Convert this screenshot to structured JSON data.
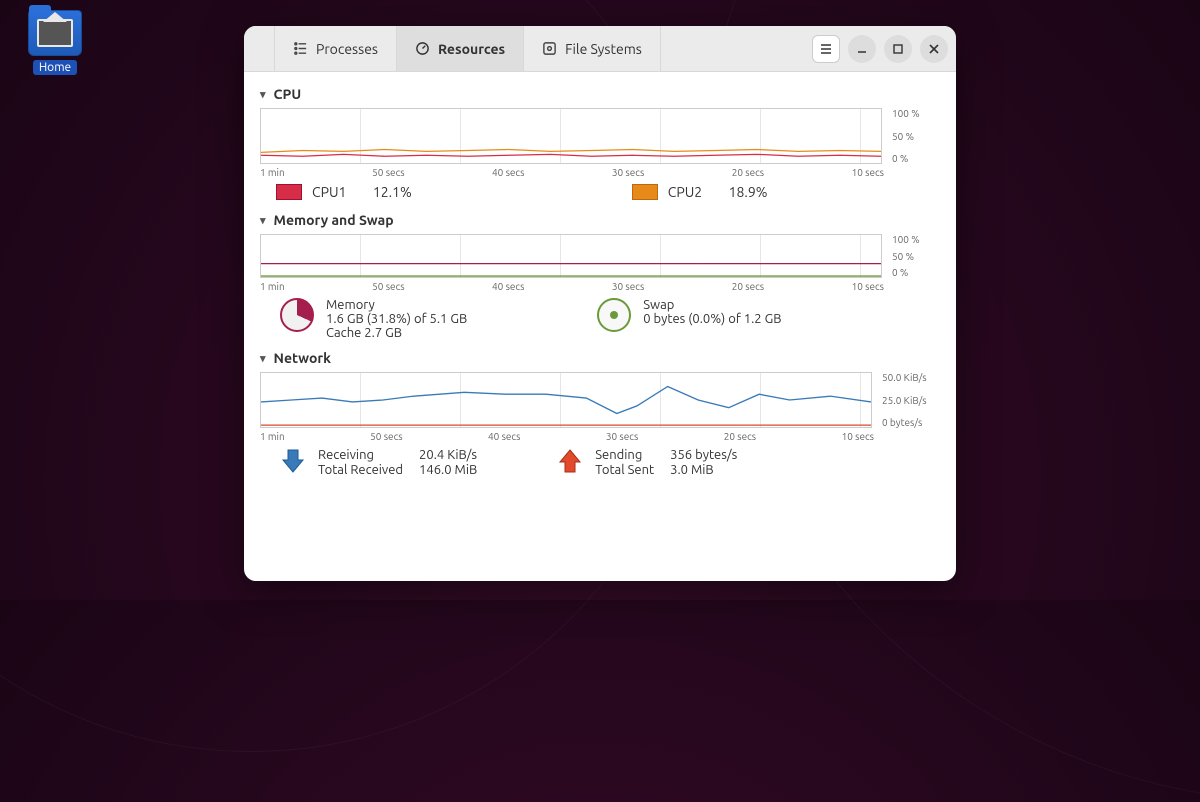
{
  "desktop": {
    "home_label": "Home"
  },
  "tabs": {
    "processes": "Processes",
    "resources": "Resources",
    "filesystems": "File Systems"
  },
  "sections": {
    "cpu": "CPU",
    "mem": "Memory and Swap",
    "net": "Network"
  },
  "xticks": [
    "1 min",
    "50 secs",
    "40 secs",
    "30 secs",
    "20 secs",
    "10 secs"
  ],
  "cpu": {
    "yticks": [
      "100 %",
      "50 %",
      "0 %"
    ],
    "cpu1": {
      "label": "CPU1",
      "pct": "12.1%",
      "color": "#d72d48"
    },
    "cpu2": {
      "label": "CPU2",
      "pct": "18.9%",
      "color": "#e88a1a"
    }
  },
  "mem": {
    "yticks": [
      "100 %",
      "50 %",
      "0 %"
    ],
    "memory": {
      "label": "Memory",
      "line": "1.6 GB (31.8%) of 5.1 GB",
      "cache": "Cache 2.7 GB"
    },
    "swap": {
      "label": "Swap",
      "line": "0 bytes (0.0%) of 1.2 GB"
    }
  },
  "net": {
    "yticks": [
      "50.0 KiB/s",
      "25.0 KiB/s",
      "0 bytes/s"
    ],
    "recv": {
      "label": "Receiving",
      "rate": "20.4 KiB/s",
      "total_label": "Total Received",
      "total": "146.0 MiB"
    },
    "send": {
      "label": "Sending",
      "rate": "356 bytes/s",
      "total_label": "Total Sent",
      "total": "3.0 MiB"
    }
  },
  "chart_data": [
    {
      "type": "line",
      "title": "CPU",
      "xlabel": "",
      "ylabel": "%",
      "ylim": [
        0,
        100
      ],
      "x": [
        60,
        50,
        40,
        30,
        20,
        10,
        0
      ],
      "series": [
        {
          "name": "CPU1",
          "color": "#d72d48",
          "values": [
            14,
            12,
            13,
            11,
            12,
            13,
            12
          ]
        },
        {
          "name": "CPU2",
          "color": "#e88a1a",
          "values": [
            20,
            18,
            19,
            18,
            19,
            20,
            19
          ]
        }
      ]
    },
    {
      "type": "line",
      "title": "Memory and Swap",
      "xlabel": "",
      "ylabel": "%",
      "ylim": [
        0,
        100
      ],
      "x": [
        60,
        50,
        40,
        30,
        20,
        10,
        0
      ],
      "series": [
        {
          "name": "Memory",
          "color": "#a61e4d",
          "values": [
            32,
            32,
            32,
            32,
            32,
            32,
            32
          ]
        },
        {
          "name": "Swap",
          "color": "#6a9a3a",
          "values": [
            0,
            0,
            0,
            0,
            0,
            0,
            0
          ]
        }
      ]
    },
    {
      "type": "line",
      "title": "Network",
      "xlabel": "",
      "ylabel": "KiB/s",
      "ylim": [
        0,
        50
      ],
      "x": [
        60,
        50,
        40,
        30,
        20,
        10,
        0
      ],
      "series": [
        {
          "name": "Receiving",
          "color": "#3a7ab8",
          "values": [
            22,
            24,
            30,
            28,
            12,
            40,
            26
          ]
        },
        {
          "name": "Sending",
          "color": "#d94a2b",
          "values": [
            1,
            1,
            1,
            1,
            1,
            1,
            1
          ]
        }
      ]
    }
  ]
}
